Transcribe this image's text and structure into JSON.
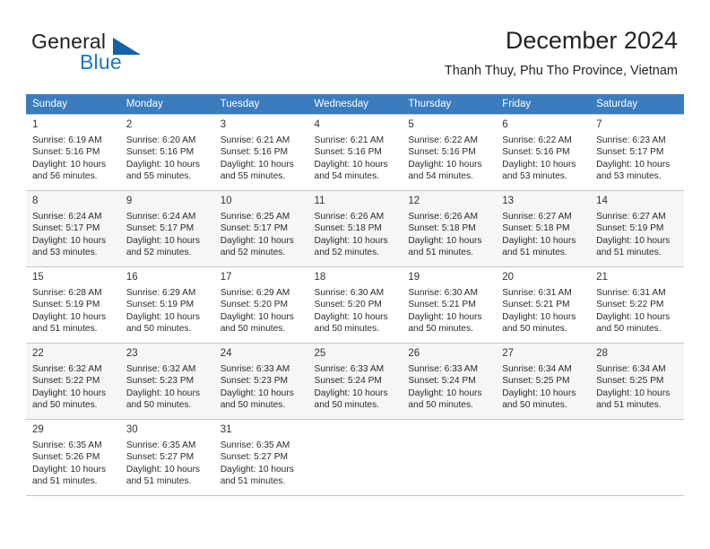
{
  "brand": {
    "name_top": "General",
    "name_bottom": "Blue",
    "accent_color": "#1878c8",
    "triangle_color": "#1461a8"
  },
  "header": {
    "title": "December 2024",
    "subtitle": "Thanh Thuy, Phu Tho Province, Vietnam"
  },
  "calendar": {
    "header_bg": "#3a7cbe",
    "header_text_color": "#ffffff",
    "weekdays": [
      "Sunday",
      "Monday",
      "Tuesday",
      "Wednesday",
      "Thursday",
      "Friday",
      "Saturday"
    ],
    "labels": {
      "sunrise": "Sunrise:",
      "sunset": "Sunset:",
      "daylight": "Daylight:"
    },
    "weeks": [
      {
        "shaded": false,
        "days": [
          {
            "num": "1",
            "sunrise": "Sunrise: 6:19 AM",
            "sunset": "Sunset: 5:16 PM",
            "daylight1": "Daylight: 10 hours",
            "daylight2": "and 56 minutes."
          },
          {
            "num": "2",
            "sunrise": "Sunrise: 6:20 AM",
            "sunset": "Sunset: 5:16 PM",
            "daylight1": "Daylight: 10 hours",
            "daylight2": "and 55 minutes."
          },
          {
            "num": "3",
            "sunrise": "Sunrise: 6:21 AM",
            "sunset": "Sunset: 5:16 PM",
            "daylight1": "Daylight: 10 hours",
            "daylight2": "and 55 minutes."
          },
          {
            "num": "4",
            "sunrise": "Sunrise: 6:21 AM",
            "sunset": "Sunset: 5:16 PM",
            "daylight1": "Daylight: 10 hours",
            "daylight2": "and 54 minutes."
          },
          {
            "num": "5",
            "sunrise": "Sunrise: 6:22 AM",
            "sunset": "Sunset: 5:16 PM",
            "daylight1": "Daylight: 10 hours",
            "daylight2": "and 54 minutes."
          },
          {
            "num": "6",
            "sunrise": "Sunrise: 6:22 AM",
            "sunset": "Sunset: 5:16 PM",
            "daylight1": "Daylight: 10 hours",
            "daylight2": "and 53 minutes."
          },
          {
            "num": "7",
            "sunrise": "Sunrise: 6:23 AM",
            "sunset": "Sunset: 5:17 PM",
            "daylight1": "Daylight: 10 hours",
            "daylight2": "and 53 minutes."
          }
        ]
      },
      {
        "shaded": true,
        "days": [
          {
            "num": "8",
            "sunrise": "Sunrise: 6:24 AM",
            "sunset": "Sunset: 5:17 PM",
            "daylight1": "Daylight: 10 hours",
            "daylight2": "and 53 minutes."
          },
          {
            "num": "9",
            "sunrise": "Sunrise: 6:24 AM",
            "sunset": "Sunset: 5:17 PM",
            "daylight1": "Daylight: 10 hours",
            "daylight2": "and 52 minutes."
          },
          {
            "num": "10",
            "sunrise": "Sunrise: 6:25 AM",
            "sunset": "Sunset: 5:17 PM",
            "daylight1": "Daylight: 10 hours",
            "daylight2": "and 52 minutes."
          },
          {
            "num": "11",
            "sunrise": "Sunrise: 6:26 AM",
            "sunset": "Sunset: 5:18 PM",
            "daylight1": "Daylight: 10 hours",
            "daylight2": "and 52 minutes."
          },
          {
            "num": "12",
            "sunrise": "Sunrise: 6:26 AM",
            "sunset": "Sunset: 5:18 PM",
            "daylight1": "Daylight: 10 hours",
            "daylight2": "and 51 minutes."
          },
          {
            "num": "13",
            "sunrise": "Sunrise: 6:27 AM",
            "sunset": "Sunset: 5:18 PM",
            "daylight1": "Daylight: 10 hours",
            "daylight2": "and 51 minutes."
          },
          {
            "num": "14",
            "sunrise": "Sunrise: 6:27 AM",
            "sunset": "Sunset: 5:19 PM",
            "daylight1": "Daylight: 10 hours",
            "daylight2": "and 51 minutes."
          }
        ]
      },
      {
        "shaded": false,
        "days": [
          {
            "num": "15",
            "sunrise": "Sunrise: 6:28 AM",
            "sunset": "Sunset: 5:19 PM",
            "daylight1": "Daylight: 10 hours",
            "daylight2": "and 51 minutes."
          },
          {
            "num": "16",
            "sunrise": "Sunrise: 6:29 AM",
            "sunset": "Sunset: 5:19 PM",
            "daylight1": "Daylight: 10 hours",
            "daylight2": "and 50 minutes."
          },
          {
            "num": "17",
            "sunrise": "Sunrise: 6:29 AM",
            "sunset": "Sunset: 5:20 PM",
            "daylight1": "Daylight: 10 hours",
            "daylight2": "and 50 minutes."
          },
          {
            "num": "18",
            "sunrise": "Sunrise: 6:30 AM",
            "sunset": "Sunset: 5:20 PM",
            "daylight1": "Daylight: 10 hours",
            "daylight2": "and 50 minutes."
          },
          {
            "num": "19",
            "sunrise": "Sunrise: 6:30 AM",
            "sunset": "Sunset: 5:21 PM",
            "daylight1": "Daylight: 10 hours",
            "daylight2": "and 50 minutes."
          },
          {
            "num": "20",
            "sunrise": "Sunrise: 6:31 AM",
            "sunset": "Sunset: 5:21 PM",
            "daylight1": "Daylight: 10 hours",
            "daylight2": "and 50 minutes."
          },
          {
            "num": "21",
            "sunrise": "Sunrise: 6:31 AM",
            "sunset": "Sunset: 5:22 PM",
            "daylight1": "Daylight: 10 hours",
            "daylight2": "and 50 minutes."
          }
        ]
      },
      {
        "shaded": true,
        "days": [
          {
            "num": "22",
            "sunrise": "Sunrise: 6:32 AM",
            "sunset": "Sunset: 5:22 PM",
            "daylight1": "Daylight: 10 hours",
            "daylight2": "and 50 minutes."
          },
          {
            "num": "23",
            "sunrise": "Sunrise: 6:32 AM",
            "sunset": "Sunset: 5:23 PM",
            "daylight1": "Daylight: 10 hours",
            "daylight2": "and 50 minutes."
          },
          {
            "num": "24",
            "sunrise": "Sunrise: 6:33 AM",
            "sunset": "Sunset: 5:23 PM",
            "daylight1": "Daylight: 10 hours",
            "daylight2": "and 50 minutes."
          },
          {
            "num": "25",
            "sunrise": "Sunrise: 6:33 AM",
            "sunset": "Sunset: 5:24 PM",
            "daylight1": "Daylight: 10 hours",
            "daylight2": "and 50 minutes."
          },
          {
            "num": "26",
            "sunrise": "Sunrise: 6:33 AM",
            "sunset": "Sunset: 5:24 PM",
            "daylight1": "Daylight: 10 hours",
            "daylight2": "and 50 minutes."
          },
          {
            "num": "27",
            "sunrise": "Sunrise: 6:34 AM",
            "sunset": "Sunset: 5:25 PM",
            "daylight1": "Daylight: 10 hours",
            "daylight2": "and 50 minutes."
          },
          {
            "num": "28",
            "sunrise": "Sunrise: 6:34 AM",
            "sunset": "Sunset: 5:25 PM",
            "daylight1": "Daylight: 10 hours",
            "daylight2": "and 51 minutes."
          }
        ]
      },
      {
        "shaded": false,
        "days": [
          {
            "num": "29",
            "sunrise": "Sunrise: 6:35 AM",
            "sunset": "Sunset: 5:26 PM",
            "daylight1": "Daylight: 10 hours",
            "daylight2": "and 51 minutes."
          },
          {
            "num": "30",
            "sunrise": "Sunrise: 6:35 AM",
            "sunset": "Sunset: 5:27 PM",
            "daylight1": "Daylight: 10 hours",
            "daylight2": "and 51 minutes."
          },
          {
            "num": "31",
            "sunrise": "Sunrise: 6:35 AM",
            "sunset": "Sunset: 5:27 PM",
            "daylight1": "Daylight: 10 hours",
            "daylight2": "and 51 minutes."
          },
          {
            "num": "",
            "sunrise": "",
            "sunset": "",
            "daylight1": "",
            "daylight2": ""
          },
          {
            "num": "",
            "sunrise": "",
            "sunset": "",
            "daylight1": "",
            "daylight2": ""
          },
          {
            "num": "",
            "sunrise": "",
            "sunset": "",
            "daylight1": "",
            "daylight2": ""
          },
          {
            "num": "",
            "sunrise": "",
            "sunset": "",
            "daylight1": "",
            "daylight2": ""
          }
        ]
      }
    ]
  }
}
